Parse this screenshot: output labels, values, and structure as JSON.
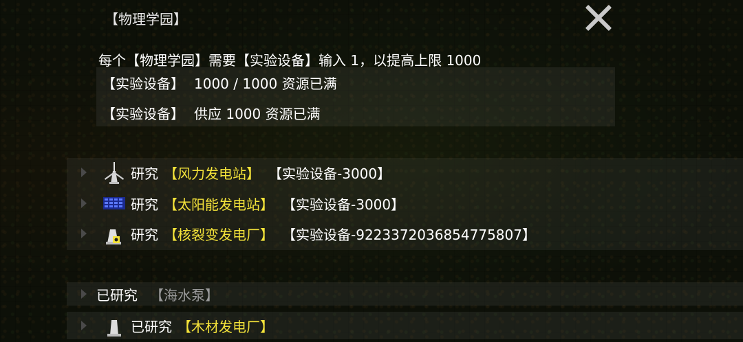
{
  "title": "【物理学园】",
  "description": "每个【物理学园】需要【实验设备】输入 1，以提高上限 1000",
  "status": {
    "storage_name": "【实验设备】",
    "storage_value": "1000 / 1000 资源已满",
    "supply_name": "【实验设备】",
    "supply_value": "供应 1000  资源已满"
  },
  "research": [
    {
      "icon": "wind-turbine-icon",
      "verb": "研究",
      "target": "【风力发电站】",
      "cost": "【实验设备-3000】"
    },
    {
      "icon": "solar-panel-icon",
      "verb": "研究",
      "target": "【太阳能发电站】",
      "cost": "【实验设备-3000】"
    },
    {
      "icon": "nuclear-plant-icon",
      "verb": "研究",
      "target": "【核裂变发电厂】",
      "cost": "【实验设备-9223372036854775807】"
    }
  ],
  "researched": [
    {
      "verb": "已研究",
      "target": "【海水泵】"
    },
    {
      "icon": "wood-power-plant-icon",
      "verb": "已研究",
      "target": "【木材发电厂】"
    }
  ],
  "colors": {
    "highlight": "#f4e33a",
    "muted": "#9a9a9a",
    "text": "#ffffff"
  }
}
